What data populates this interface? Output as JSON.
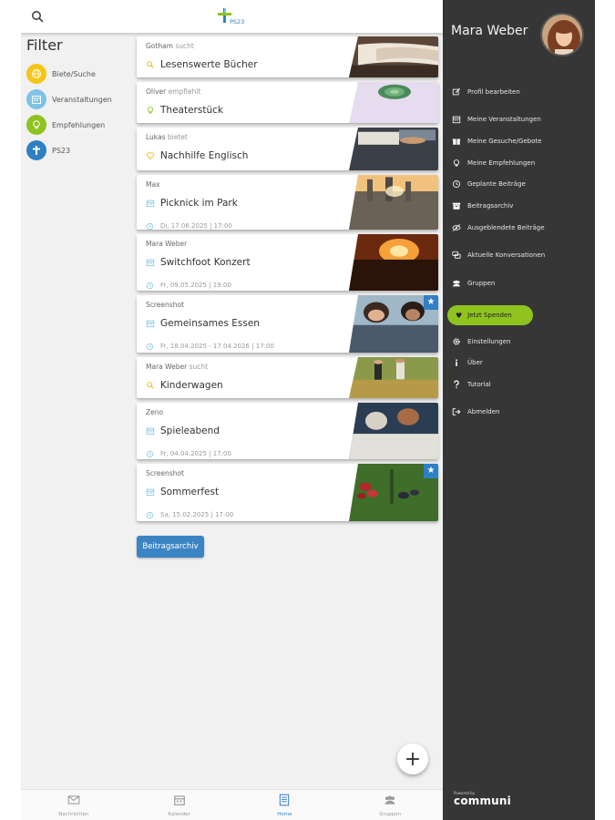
{
  "topbar": {
    "logo_text": "PS23"
  },
  "filter": {
    "title": "Filter",
    "items": [
      {
        "label": "Biete/Suche",
        "icon": "globe-icon",
        "color": "#f5c518"
      },
      {
        "label": "Veranstaltungen",
        "icon": "calendar-icon",
        "color": "#7ec3e6"
      },
      {
        "label": "Empfehlungen",
        "icon": "lightbulb-icon",
        "color": "#8fc31f"
      },
      {
        "label": "PS23",
        "icon": "cross-icon",
        "color": "#2e7fc3"
      }
    ]
  },
  "feed": {
    "cards": [
      {
        "author": "Gotham",
        "verb": "sucht",
        "type": "search",
        "title": "Lesenswerte Bücher",
        "date": "",
        "image": "book-photo",
        "starred": false
      },
      {
        "author": "Oliver",
        "verb": "empfiehlt",
        "type": "recommend",
        "title": "Theaterstück",
        "date": "",
        "image": "succulent-photo",
        "starred": false
      },
      {
        "author": "Lukas",
        "verb": "bietet",
        "type": "offer",
        "title": "Nachhilfe Englisch",
        "date": "",
        "image": "study-photo",
        "starred": false
      },
      {
        "author": "Max",
        "verb": "",
        "type": "event",
        "title": "Picknick im Park",
        "date": "Di, 17.06.2025 | 17:00",
        "image": "park-photo",
        "starred": false
      },
      {
        "author": "Mara Weber",
        "verb": "",
        "type": "event",
        "title": "Switchfoot Konzert",
        "date": "Fr, 09.05.2025 | 19:00",
        "image": "concert-photo",
        "starred": false
      },
      {
        "author": "Screenshot",
        "verb": "",
        "type": "event",
        "title": "Gemeinsames Essen",
        "date": "Fr, 18.04.2025 - 17.04.2026 | 17:00",
        "image": "dinner-photo",
        "starred": true
      },
      {
        "author": "Mara Weber",
        "verb": "sucht",
        "type": "search",
        "title": "Kinderwagen",
        "date": "",
        "image": "family-photo",
        "starred": false
      },
      {
        "author": "Zeno",
        "verb": "",
        "type": "event",
        "title": "Spieleabend",
        "date": "Fr, 04.04.2025 | 17:00",
        "image": "games-photo",
        "starred": false
      },
      {
        "author": "Screenshot",
        "verb": "",
        "type": "event",
        "title": "Sommerfest",
        "date": "Sa, 15.02.2025 | 17:00",
        "image": "berries-photo",
        "starred": true
      }
    ],
    "archive_button": "Beitragsarchiv"
  },
  "fab": {
    "label": "+"
  },
  "bottom_nav": [
    {
      "label": "Nachrichten",
      "icon": "mail-icon",
      "active": false
    },
    {
      "label": "Kalender",
      "icon": "calendar-icon",
      "active": false
    },
    {
      "label": "Home",
      "icon": "list-icon",
      "active": true
    },
    {
      "label": "Gruppen",
      "icon": "group-icon",
      "active": false
    }
  ],
  "drawer": {
    "user_name": "Mara Weber",
    "menu": [
      {
        "label": "Profil bearbeiten",
        "icon": "edit-icon"
      },
      {
        "label": "Meine Veranstaltungen",
        "icon": "calendar-icon"
      },
      {
        "label": "Meine Gesuche/Gebote",
        "icon": "gift-icon"
      },
      {
        "label": "Meine Empfehlungen",
        "icon": "lightbulb-icon"
      },
      {
        "label": "Geplante Beiträge",
        "icon": "clock-icon"
      },
      {
        "label": "Beitragsarchiv",
        "icon": "archive-icon"
      },
      {
        "label": "Ausgeblendete Beiträge",
        "icon": "eye-off-icon"
      },
      {
        "label": "Aktuelle Konversationen",
        "icon": "chat-icon"
      },
      {
        "label": "Gruppen",
        "icon": "group-icon"
      }
    ],
    "donate_label": "Jetzt Spenden",
    "menu_bottom": [
      {
        "label": "Einstellungen",
        "icon": "gear-icon"
      },
      {
        "label": "Über",
        "icon": "info-icon"
      },
      {
        "label": "Tutorial",
        "icon": "question-icon"
      },
      {
        "label": "Abmelden",
        "icon": "logout-icon"
      }
    ],
    "powered_small": "Powered by",
    "powered_brand": "communi"
  },
  "colors": {
    "accent": "#3b84c4",
    "drawer_bg": "#363636",
    "donate": "#8fc31f",
    "star": "#2f7fc6"
  }
}
